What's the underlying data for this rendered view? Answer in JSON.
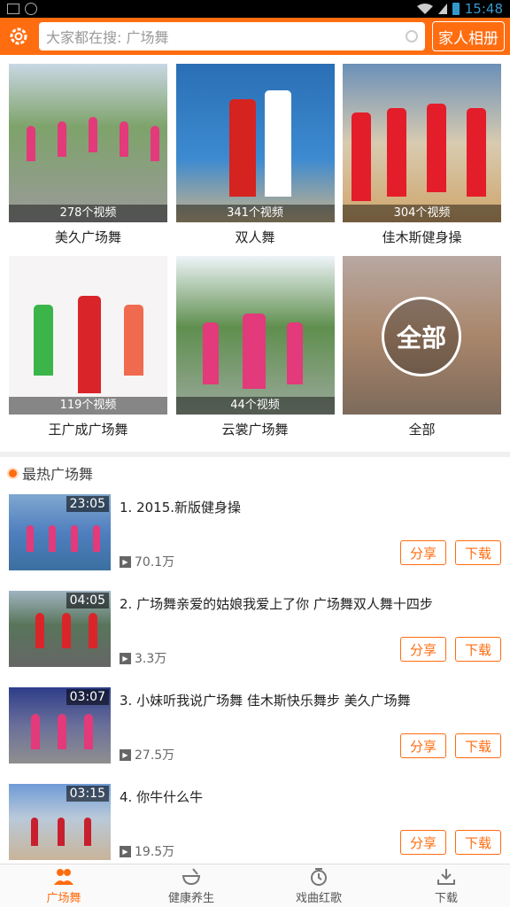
{
  "statusbar": {
    "time": "15:48"
  },
  "header": {
    "search_placeholder": "大家都在搜: 广场舞",
    "family_album": "家人相册",
    "icons": {
      "settings": "gear-icon",
      "search": "search-icon"
    }
  },
  "categories": [
    {
      "label": "美久广场舞",
      "count": "278个视频"
    },
    {
      "label": "双人舞",
      "count": "341个视频"
    },
    {
      "label": "佳木斯健身操",
      "count": "304个视频"
    },
    {
      "label": "王广成广场舞",
      "count": "119个视频"
    },
    {
      "label": "云裳广场舞",
      "count": "44个视频"
    },
    {
      "label": "全部",
      "overlay": "全部"
    }
  ],
  "hot_section": {
    "title": "最热广场舞"
  },
  "videos": [
    {
      "title": "1. 2015.新版健身操",
      "duration": "23:05",
      "plays": "70.1万",
      "share": "分享",
      "download": "下载"
    },
    {
      "title": "2. 广场舞亲爱的姑娘我爱上了你 广场舞双人舞十四步",
      "duration": "04:05",
      "plays": "3.3万",
      "share": "分享",
      "download": "下载"
    },
    {
      "title": "3. 小妹听我说广场舞 佳木斯快乐舞步  美久广场舞",
      "duration": "03:07",
      "plays": "27.5万",
      "share": "分享",
      "download": "下载"
    },
    {
      "title": "4. 你牛什么牛",
      "duration": "03:15",
      "plays": "19.5万",
      "share": "分享",
      "download": "下载"
    }
  ],
  "tabs": [
    {
      "label": "广场舞",
      "icon": "people-icon",
      "active": true
    },
    {
      "label": "健康养生",
      "icon": "bowl-icon",
      "active": false
    },
    {
      "label": "戏曲红歌",
      "icon": "clock-icon",
      "active": false
    },
    {
      "label": "下载",
      "icon": "download-icon",
      "active": false
    }
  ],
  "colors": {
    "accent": "#ff6d10"
  }
}
